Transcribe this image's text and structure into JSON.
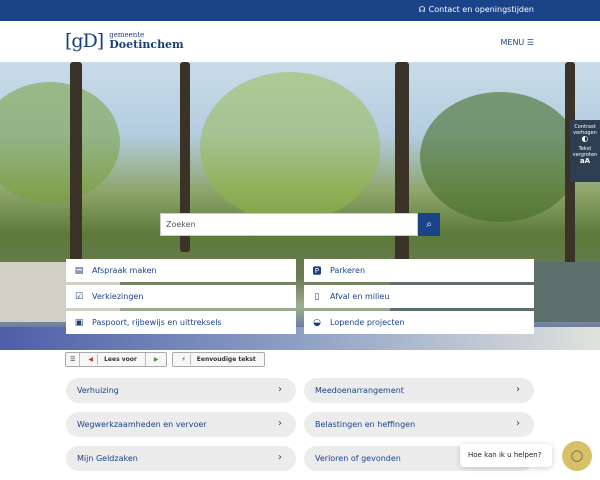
{
  "topbar": {
    "contact": "Contact en openingstijden"
  },
  "header": {
    "logo_mark": "[gD]",
    "logo_small": "gemeente",
    "logo_big": "Doetinchem",
    "menu": "MENU ☰"
  },
  "a11y": {
    "contrast": "Contrast verhogen",
    "text": "Tekst vergroten"
  },
  "search": {
    "placeholder": "Zoeken"
  },
  "tiles": [
    {
      "label": "Afspraak maken",
      "icon": "calendar-icon"
    },
    {
      "label": "Parkeren",
      "icon": "parking-icon"
    },
    {
      "label": "Verkiezingen",
      "icon": "checkbox-icon"
    },
    {
      "label": "Afval en milieu",
      "icon": "bin-icon"
    },
    {
      "label": "Paspoort, rijbewijs en uittreksels",
      "icon": "passport-icon"
    },
    {
      "label": "Lopende projecten",
      "icon": "hardhat-icon"
    }
  ],
  "tools": {
    "read": "Lees voor",
    "simple": "Eenvoudige tekst"
  },
  "links": [
    {
      "label": "Verhuizing"
    },
    {
      "label": "Meedoenarrangement"
    },
    {
      "label": "Wegwerkzaamheden en vervoer"
    },
    {
      "label": "Belastingen en heffingen"
    },
    {
      "label": "Mijn Geldzaken"
    },
    {
      "label": "Verloren of gevonden"
    }
  ],
  "chat": {
    "prompt": "Hoe kan ik u helpen?"
  }
}
